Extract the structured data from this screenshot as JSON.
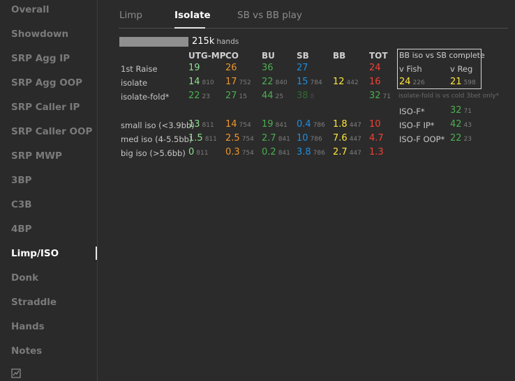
{
  "sidebar": {
    "items": [
      "Overall",
      "Showdown",
      "SRP Agg IP",
      "SRP Agg OOP",
      "SRP Caller IP",
      "SRP Caller OOP",
      "SRP MWP",
      "3BP",
      "C3B",
      "4BP",
      "Limp/ISO",
      "Donk",
      "Straddle",
      "Hands",
      "Notes"
    ],
    "active": "Limp/ISO",
    "bottom_icon": "chart-icon"
  },
  "tabs": [
    "Limp",
    "Isolate",
    "SB vs BB play"
  ],
  "active_tab": "Isolate",
  "hands": {
    "count": "215k",
    "unit": "hands"
  },
  "table": {
    "headers": [
      "UTG-MP",
      "CO",
      "BU",
      "SB",
      "BB",
      "TOT"
    ],
    "row_labels": {
      "raise": "1st Raise",
      "isolate": "isolate",
      "isofold": "isolate-fold*",
      "small": "small iso (<3.9bb)",
      "med": "med iso (4-5.5bb)",
      "big": "big iso (>5.6bb)"
    },
    "raise": [
      "19",
      "26",
      "36",
      "27",
      "",
      "24"
    ],
    "isolate": {
      "v": [
        "14",
        "17",
        "22",
        "15",
        "12",
        "16"
      ],
      "n": [
        "810",
        "752",
        "840",
        "784",
        "442",
        ""
      ]
    },
    "isofold": {
      "v": [
        "22",
        "27",
        "44",
        "38",
        "",
        "32"
      ],
      "n": [
        "23",
        "15",
        "25",
        "8",
        "",
        "71"
      ]
    },
    "small": {
      "v": [
        "13",
        "14",
        "19",
        "0.4",
        "1.8",
        "10"
      ],
      "n": [
        "811",
        "754",
        "841",
        "786",
        "447",
        ""
      ]
    },
    "med": {
      "v": [
        "1.5",
        "2.5",
        "2.7",
        "10",
        "7.6",
        "4.7"
      ],
      "n": [
        "811",
        "754",
        "841",
        "786",
        "447",
        ""
      ]
    },
    "big": {
      "v": [
        "0",
        "0.3",
        "0.2",
        "3.8",
        "2.7",
        "1.3"
      ],
      "n": [
        "811",
        "754",
        "841",
        "786",
        "447",
        ""
      ]
    }
  },
  "bb_panel": {
    "title": "BB iso vs SB complete",
    "col_fish": "v Fish",
    "col_reg": "v Reg",
    "fish": {
      "v": "24",
      "n": "226"
    },
    "reg": {
      "v": "21",
      "n": "598"
    }
  },
  "note": "isolate-fold is vs cold 3bet only*",
  "isof_stats": {
    "rows": [
      {
        "label": "ISO-F*",
        "v": "32",
        "n": "71"
      },
      {
        "label": "ISO-F IP*",
        "v": "42",
        "n": "43"
      },
      {
        "label": "ISO-F OOP*",
        "v": "22",
        "n": "23"
      }
    ]
  },
  "colors": {
    "light_green": "#8ee08e",
    "orange": "#f0962a",
    "green": "#4caf50",
    "blue": "#1e8fe0",
    "red": "#f04235",
    "yellow": "#ffe63b",
    "dark_green": "#2f6b2f"
  }
}
